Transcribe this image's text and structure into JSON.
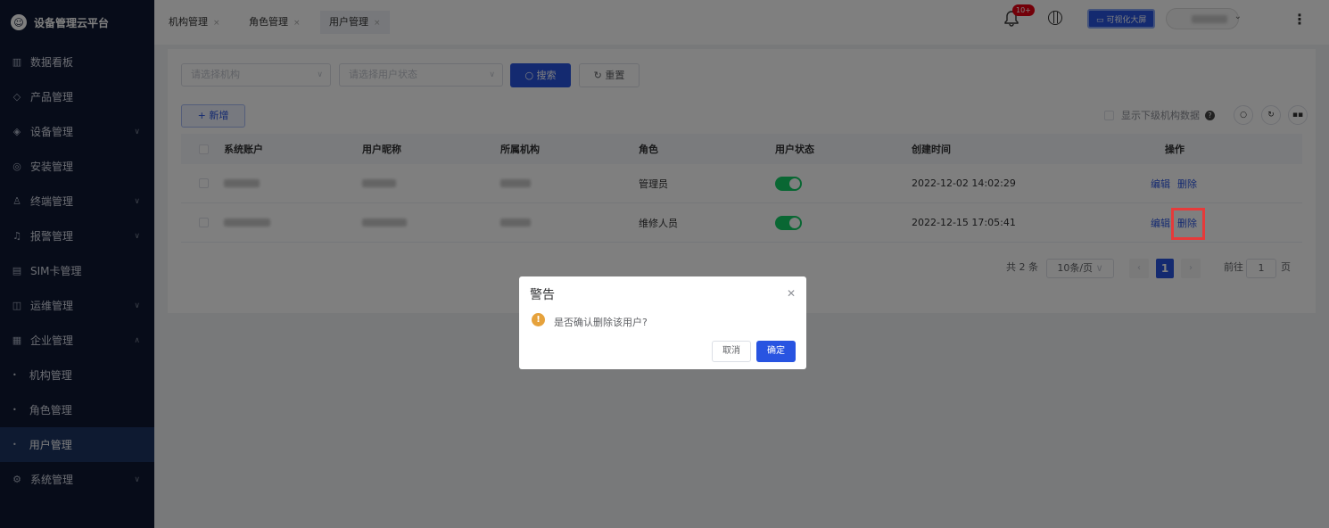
{
  "brand": {
    "title": "设备管理云平台"
  },
  "sidebar": {
    "items": [
      {
        "label": "数据看板",
        "icon": "chart-icon",
        "icon_glyph": "▥",
        "chevron": false
      },
      {
        "label": "产品管理",
        "icon": "cube-icon",
        "icon_glyph": "◇",
        "chevron": false
      },
      {
        "label": "设备管理",
        "icon": "layers-icon",
        "icon_glyph": "◈",
        "chevron": true
      },
      {
        "label": "安装管理",
        "icon": "install-icon",
        "icon_glyph": "◎",
        "chevron": false
      },
      {
        "label": "终端管理",
        "icon": "user-icon",
        "icon_glyph": "♙",
        "chevron": true
      },
      {
        "label": "报警管理",
        "icon": "alarm-icon",
        "icon_glyph": "♫",
        "chevron": true
      },
      {
        "label": "SIM卡管理",
        "icon": "sim-icon",
        "icon_glyph": "▤",
        "chevron": false
      },
      {
        "label": "运维管理",
        "icon": "tool-icon",
        "icon_glyph": "◫",
        "chevron": true
      },
      {
        "label": "企业管理",
        "icon": "building-icon",
        "icon_glyph": "▦",
        "chevron": true,
        "expanded": true
      },
      {
        "label": "机构管理",
        "sub": true
      },
      {
        "label": "角色管理",
        "sub": true
      },
      {
        "label": "用户管理",
        "sub": true,
        "active": true
      },
      {
        "label": "系统管理",
        "icon": "settings-icon",
        "icon_glyph": "⚙",
        "chevron": true
      }
    ]
  },
  "tabs": [
    {
      "label": "机构管理"
    },
    {
      "label": "角色管理"
    },
    {
      "label": "用户管理",
      "active": true
    }
  ],
  "header": {
    "notification_count": "10+",
    "visual_screen_label": "可视化大屏"
  },
  "filters": {
    "org_placeholder": "请选择机构",
    "status_placeholder": "请选择用户状态",
    "search_label": "搜索",
    "reset_label": "重置"
  },
  "toolbar": {
    "add_label": "新增",
    "show_sub_label": "显示下级机构数据"
  },
  "table": {
    "columns": [
      "系统账户",
      "用户昵称",
      "所属机构",
      "角色",
      "用户状态",
      "创建时间",
      "操作"
    ],
    "rows": [
      {
        "role": "管理员",
        "status_enabled": true,
        "created": "2022-12-02 14:02:29",
        "edit": "编辑",
        "delete": "删除"
      },
      {
        "role": "维修人员",
        "status_enabled": true,
        "created": "2022-12-15 17:05:41",
        "edit": "编辑",
        "delete": "删除"
      }
    ]
  },
  "pagination": {
    "total": "共 2 条",
    "page_size": "10条/页",
    "current": "1",
    "goto_prefix": "前往",
    "goto_value": "1",
    "goto_suffix": "页"
  },
  "dialog": {
    "title": "警告",
    "message": "是否确认删除该用户?",
    "cancel": "取消",
    "confirm": "确定"
  },
  "colors": {
    "sidebar_bg": "#0f1933",
    "primary": "#2854e1",
    "toggle_on": "#13ce66",
    "highlight": "#e63a3a",
    "warning": "#e6a23c"
  }
}
